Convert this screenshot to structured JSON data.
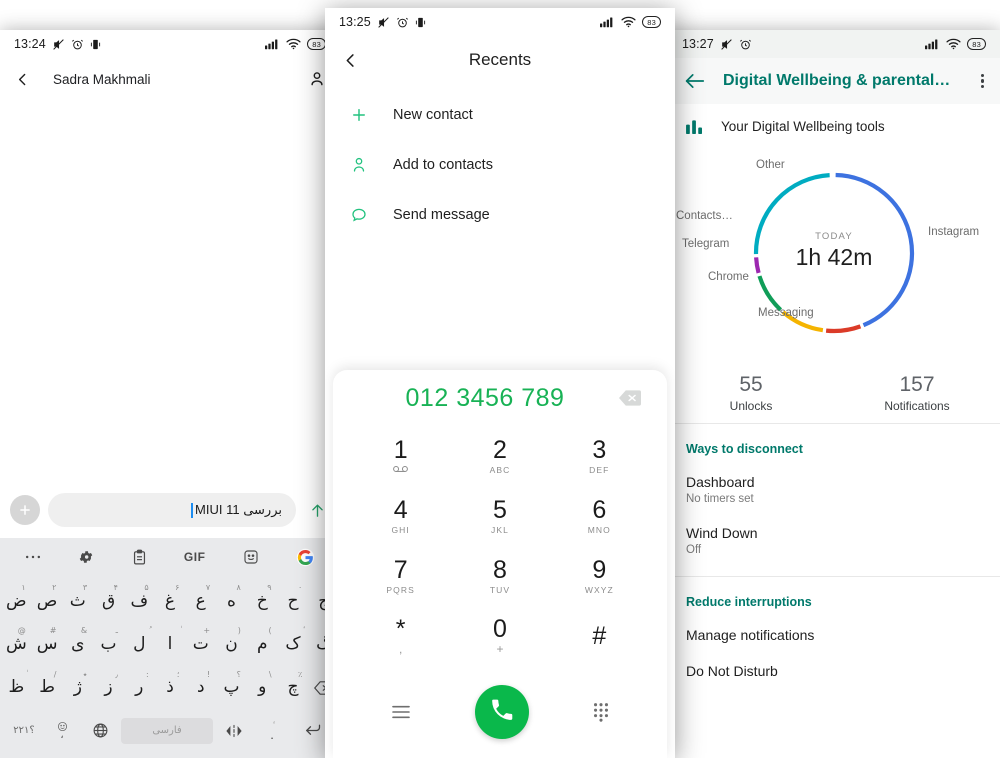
{
  "left_phone": {
    "status": {
      "time": "13:24",
      "battery": "83",
      "icons": [
        "mute-icon",
        "alarm-icon",
        "vibrate-icon",
        "signal-icon",
        "wifi-icon",
        "battery-icon"
      ]
    },
    "appbar": {
      "back_icon": "chevron-left-icon",
      "title": "Sadra Makhmali",
      "person_icon": "person-icon"
    },
    "composer": {
      "plus_label": "+",
      "message_value": "بررسی MIUI 11",
      "send_icon": "arrow-up-icon"
    },
    "keyboard": {
      "toolbar": [
        "...",
        "gear-icon",
        "clipboard-icon",
        "GIF",
        "sticker-icon",
        "google-icon"
      ],
      "row1": [
        {
          "main": "ض",
          "sup": "۱"
        },
        {
          "main": "ص",
          "sup": "۲"
        },
        {
          "main": "ث",
          "sup": "۳"
        },
        {
          "main": "ق",
          "sup": "۴"
        },
        {
          "main": "ف",
          "sup": "۵"
        },
        {
          "main": "غ",
          "sup": "۶"
        },
        {
          "main": "ع",
          "sup": "۷"
        },
        {
          "main": "ه",
          "sup": "۸"
        },
        {
          "main": "خ",
          "sup": "۹"
        },
        {
          "main": "ح",
          "sup": "۰"
        },
        {
          "main": "ج",
          "sup": ""
        }
      ],
      "row2": [
        {
          "main": "ش",
          "sup": "@"
        },
        {
          "main": "س",
          "sup": "#"
        },
        {
          "main": "ی",
          "sup": "&"
        },
        {
          "main": "ب",
          "sup": "ـ"
        },
        {
          "main": "ل",
          "sup": "ُ"
        },
        {
          "main": "ا",
          "sup": "ٰ"
        },
        {
          "main": "ت",
          "sup": "+"
        },
        {
          "main": "ن",
          "sup": ")"
        },
        {
          "main": "م",
          "sup": "("
        },
        {
          "main": "ک",
          "sup": "ٔ"
        },
        {
          "main": "گ",
          "sup": ""
        }
      ],
      "row3": [
        {
          "main": "ظ",
          "sup": "ٰ"
        },
        {
          "main": "ط",
          "sup": "/"
        },
        {
          "main": "ژ",
          "sup": "٭"
        },
        {
          "main": "ز",
          "sup": "٫"
        },
        {
          "main": "ر",
          "sup": ":"
        },
        {
          "main": "ذ",
          "sup": "؛"
        },
        {
          "main": "د",
          "sup": "!"
        },
        {
          "main": "پ",
          "sup": "؟"
        },
        {
          "main": "و",
          "sup": "\\"
        },
        {
          "main": "چ",
          "sup": "٪"
        },
        {
          "main": "backspace-icon",
          "sup": ""
        }
      ],
      "bottom": {
        "numbers": "؟۲۲۱",
        "emoji": "emoji-icon",
        "comma": "،",
        "globe": "globe-icon",
        "space_label": "فارسی",
        "cursor_icon": "cursor-move-icon",
        "period": ".",
        "enter_icon": "enter-icon"
      }
    }
  },
  "center_phone": {
    "status": {
      "time": "13:25",
      "battery": "83"
    },
    "appbar": {
      "back_icon": "chevron-left-icon",
      "title": "Recents"
    },
    "menu": [
      {
        "icon": "plus-icon",
        "label": "New contact"
      },
      {
        "icon": "person-add-icon",
        "label": "Add to contacts"
      },
      {
        "icon": "message-icon",
        "label": "Send message"
      }
    ],
    "dialer": {
      "number": "012 3456 789",
      "backspace_icon": "backspace-icon",
      "keys": [
        {
          "digit": "1",
          "sub": "voicemail-icon",
          "sub_type": "icon"
        },
        {
          "digit": "2",
          "sub": "ABC",
          "sub_type": "text"
        },
        {
          "digit": "3",
          "sub": "DEF",
          "sub_type": "text"
        },
        {
          "digit": "4",
          "sub": "GHI",
          "sub_type": "text"
        },
        {
          "digit": "5",
          "sub": "JKL",
          "sub_type": "text"
        },
        {
          "digit": "6",
          "sub": "MNO",
          "sub_type": "text"
        },
        {
          "digit": "7",
          "sub": "PQRS",
          "sub_type": "text"
        },
        {
          "digit": "8",
          "sub": "TUV",
          "sub_type": "text"
        },
        {
          "digit": "9",
          "sub": "WXYZ",
          "sub_type": "text"
        },
        {
          "digit": "*",
          "sub": ",",
          "sub_type": "sym"
        },
        {
          "digit": "0",
          "sub": "+",
          "sub_type": "sym"
        },
        {
          "digit": "#",
          "sub": "",
          "sub_type": "text"
        }
      ],
      "actions": {
        "left_icon": "menu-icon",
        "call_icon": "phone-icon",
        "right_icon": "dialpad-icon"
      },
      "call_color": "#0ab84b",
      "number_color": "#18b255"
    }
  },
  "right_phone": {
    "status": {
      "time": "13:27",
      "battery": "83"
    },
    "appbar": {
      "back_icon": "arrow-left-icon",
      "title": "Digital Wellbeing & parental…",
      "overflow_icon": "more-vert-icon",
      "accent": "#00796b"
    },
    "tools_row": {
      "icon": "bar-chart-icon",
      "label": "Your Digital Wellbeing tools"
    },
    "stats": [
      {
        "value": "55",
        "label": "Unlocks"
      },
      {
        "value": "157",
        "label": "Notifications"
      }
    ],
    "sections": [
      {
        "title": "Ways to disconnect",
        "items": [
          {
            "title": "Dashboard",
            "sub": "No timers set"
          },
          {
            "title": "Wind Down",
            "sub": "Off"
          }
        ]
      },
      {
        "title": "Reduce interruptions",
        "items": [
          {
            "title": "Manage notifications",
            "sub": ""
          },
          {
            "title": "Do Not Disturb",
            "sub": ""
          }
        ]
      }
    ],
    "chart_data": {
      "type": "pie",
      "title": "TODAY",
      "center_label": "1h 42m",
      "total_minutes": 102,
      "categories": [
        "Instagram",
        "Messaging",
        "Chrome",
        "Telegram",
        "Contacts…",
        "Other"
      ],
      "values": [
        45,
        8,
        10,
        9,
        4,
        26
      ],
      "unit": "minutes",
      "colors": [
        "#3d72e0",
        "#db3b28",
        "#f5b400",
        "#109d58",
        "#9c27b0",
        "#00acc1"
      ],
      "legend": "around-ring",
      "labels": [
        {
          "name": "Instagram",
          "color": "#3d72e0",
          "start_deg": 0,
          "end_deg": 159
        },
        {
          "name": "Messaging",
          "color": "#db3b28",
          "start_deg": 159,
          "end_deg": 187
        },
        {
          "name": "Chrome",
          "color": "#f5b400",
          "start_deg": 187,
          "end_deg": 222
        },
        {
          "name": "Telegram",
          "color": "#109d58",
          "start_deg": 222,
          "end_deg": 254
        },
        {
          "name": "Contacts…",
          "color": "#9c27b0",
          "start_deg": 254,
          "end_deg": 268
        },
        {
          "name": "Other",
          "color": "#00acc1",
          "start_deg": 268,
          "end_deg": 358
        }
      ]
    }
  }
}
